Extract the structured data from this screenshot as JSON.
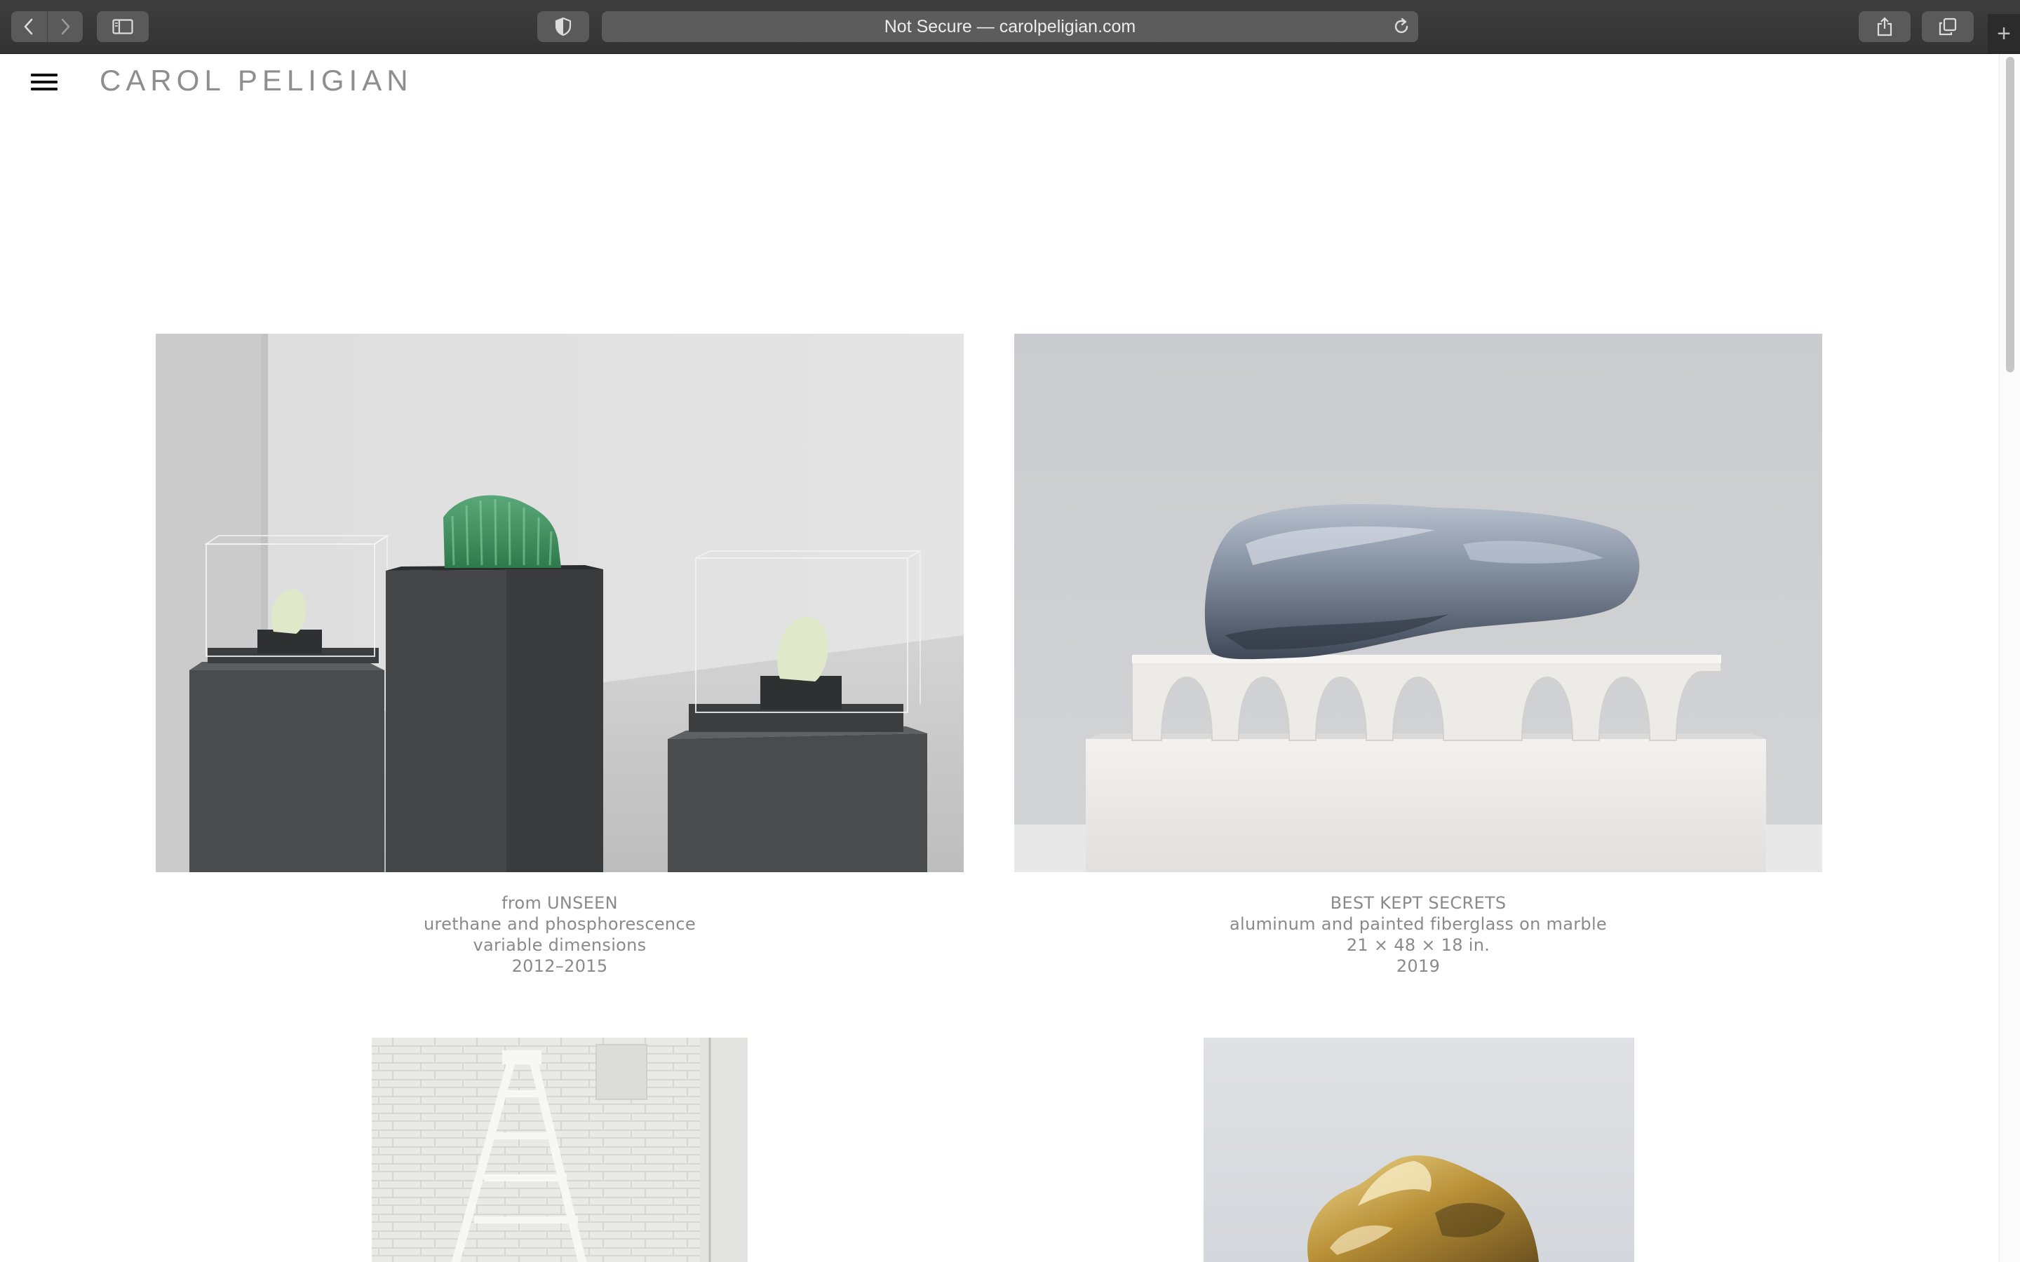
{
  "browser": {
    "address": "Not Secure — carolpeligian.com",
    "new_tab_glyph": "+"
  },
  "site": {
    "title": "CAROL PELIGIAN"
  },
  "works": [
    {
      "title": "from UNSEEN",
      "medium": "urethane and phosphorescence",
      "dimensions": "variable dimensions",
      "year": "2012–2015"
    },
    {
      "title": "BEST KEPT SECRETS",
      "medium": "aluminum and painted fiberglass on marble",
      "dimensions": "21 × 48 × 18 in.",
      "year": "2019"
    }
  ],
  "icons": [
    "back-icon",
    "forward-icon",
    "sidebar-icon",
    "privacy-shield-icon",
    "reload-icon",
    "share-icon",
    "tabs-icon",
    "menu-icon"
  ],
  "colors": {
    "chrome": "#383838",
    "title_gray": "#8e8e8e",
    "caption_gray": "#8a8a8a"
  }
}
